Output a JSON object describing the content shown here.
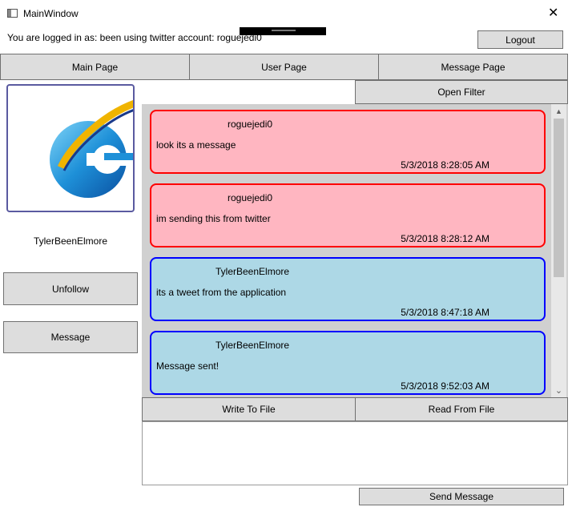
{
  "window": {
    "title": "MainWindow",
    "close_glyph": "✕",
    "status_text": "You are logged in as: been using twitter account: roguejedi0",
    "logout_label": "Logout"
  },
  "tabs": [
    {
      "label": "Main Page"
    },
    {
      "label": "User Page"
    },
    {
      "label": "Message Page"
    }
  ],
  "profile": {
    "avatar_icon": "internet-explorer-logo-icon",
    "username": "TylerBeenElmore",
    "unfollow_label": "Unfollow",
    "message_label": "Message"
  },
  "filter": {
    "open_filter_label": "Open Filter"
  },
  "messages": [
    {
      "sender": "roguejedi0",
      "text": "look its a message",
      "time": "5/3/2018 8:28:05 AM",
      "style": "incoming"
    },
    {
      "sender": "roguejedi0",
      "text": "im sending this from twitter",
      "time": "5/3/2018 8:28:12 AM",
      "style": "incoming"
    },
    {
      "sender": "TylerBeenElmore",
      "text": "its a tweet from the application",
      "time": "5/3/2018 8:47:18 AM",
      "style": "outgoing"
    },
    {
      "sender": "TylerBeenElmore",
      "text": "Message sent!",
      "time": "5/3/2018 9:52:03 AM",
      "style": "outgoing"
    }
  ],
  "colors": {
    "incoming_bg": "#ffb6c1",
    "incoming_border": "#ff0000",
    "outgoing_bg": "#add8e6",
    "outgoing_border": "#0000ff",
    "list_bg": "#d0d0d0",
    "button_bg": "#dddddd"
  },
  "file_actions": {
    "write_label": "Write To File",
    "read_label": "Read From File"
  },
  "compose": {
    "value": "",
    "send_label": "Send Message"
  }
}
